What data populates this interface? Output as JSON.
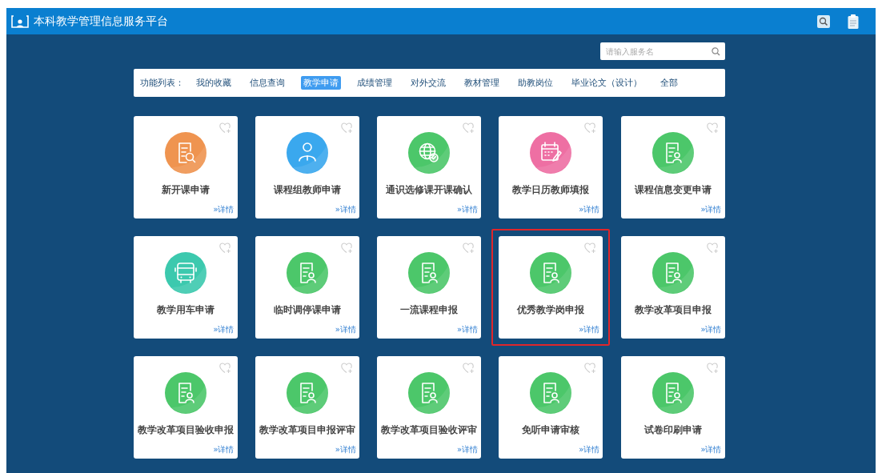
{
  "header": {
    "title": "本科教学管理信息服务平台"
  },
  "search": {
    "placeholder": "请输入服务名"
  },
  "nav": {
    "label": "功能列表：",
    "items": [
      {
        "label": "我的收藏",
        "selected": false
      },
      {
        "label": "信息查询",
        "selected": false
      },
      {
        "label": "教学申请",
        "selected": true
      },
      {
        "label": "成绩管理",
        "selected": false
      },
      {
        "label": "对外交流",
        "selected": false
      },
      {
        "label": "教材管理",
        "selected": false
      },
      {
        "label": "助教岗位",
        "selected": false
      },
      {
        "label": "毕业论文（设计）",
        "selected": false
      },
      {
        "label": "全部",
        "selected": false
      }
    ]
  },
  "cards": [
    {
      "title": "新开课申请",
      "kind": "doc-search",
      "color": "#ef9450",
      "link": "»详情",
      "highlighted": false
    },
    {
      "title": "课程组教师申请",
      "kind": "person",
      "color": "#3aa8ee",
      "link": "»详情",
      "highlighted": false
    },
    {
      "title": "通识选修课开课确认",
      "kind": "globe",
      "color": "#4cc76a",
      "link": "»详情",
      "highlighted": false
    },
    {
      "title": "教学日历教师填报",
      "kind": "calendar",
      "color": "#ee6fa3",
      "link": "»详情",
      "highlighted": false
    },
    {
      "title": "课程信息变更申请",
      "kind": "doc-person",
      "color": "#4cc76a",
      "link": "»详情",
      "highlighted": false
    },
    {
      "title": "教学用车申请",
      "kind": "bus",
      "color": "#3cc9ae",
      "link": "»详情",
      "highlighted": false
    },
    {
      "title": "临时调停课申请",
      "kind": "doc-person",
      "color": "#4cc76a",
      "link": "»详情",
      "highlighted": false
    },
    {
      "title": "一流课程申报",
      "kind": "doc-person",
      "color": "#4cc76a",
      "link": "»详情",
      "highlighted": false
    },
    {
      "title": "优秀教学岗申报",
      "kind": "doc-person",
      "color": "#4cc76a",
      "link": "»详情",
      "highlighted": true
    },
    {
      "title": "教学改革项目申报",
      "kind": "doc-person",
      "color": "#4cc76a",
      "link": "»详情",
      "highlighted": false
    },
    {
      "title": "教学改革项目验收申报",
      "kind": "doc-person",
      "color": "#4cc76a",
      "link": "»详情",
      "highlighted": false
    },
    {
      "title": "教学改革项目申报评审",
      "kind": "doc-person",
      "color": "#4cc76a",
      "link": "»详情",
      "highlighted": false
    },
    {
      "title": "教学改革项目验收评审",
      "kind": "doc-person",
      "color": "#4cc76a",
      "link": "»详情",
      "highlighted": false
    },
    {
      "title": "免听申请审核",
      "kind": "doc-person",
      "color": "#4cc76a",
      "link": "»详情",
      "highlighted": false
    },
    {
      "title": "试卷印刷申请",
      "kind": "doc-person",
      "color": "#4cc76a",
      "link": "»详情",
      "highlighted": false
    }
  ]
}
